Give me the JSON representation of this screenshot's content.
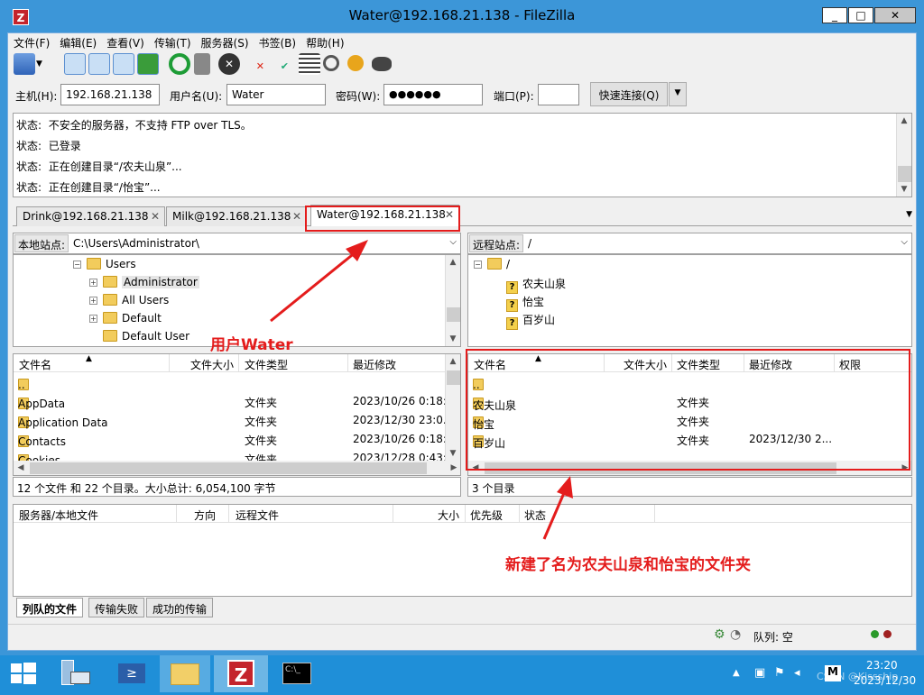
{
  "window": {
    "title": "Water@192.168.21.138 - FileZilla",
    "app_icon": "Z"
  },
  "menu": [
    "文件(F)",
    "编辑(E)",
    "查看(V)",
    "传输(T)",
    "服务器(S)",
    "书签(B)",
    "帮助(H)"
  ],
  "quickconnect": {
    "host_label": "主机(H):",
    "host_value": "192.168.21.138",
    "user_label": "用户名(U):",
    "user_value": "Water",
    "pass_label": "密码(W):",
    "pass_value": "●●●●●●",
    "port_label": "端口(P):",
    "port_value": "",
    "connect_label": "快速连接(Q)"
  },
  "log": [
    {
      "label": "状态:",
      "text": "不安全的服务器，不支持 FTP over TLS。"
    },
    {
      "label": "状态:",
      "text": "已登录"
    },
    {
      "label": "状态:",
      "text": "正在创建目录“/农夫山泉”..."
    },
    {
      "label": "状态:",
      "text": "正在创建目录“/怡宝”..."
    }
  ],
  "tabs": [
    "Drink@192.168.21.138",
    "Milk@192.168.21.138",
    "Water@192.168.21.138"
  ],
  "local": {
    "site_label": "本地站点:",
    "site_path": "C:\\Users\\Administrator\\",
    "tree": [
      "Users",
      "Administrator",
      "All Users",
      "Default",
      "Default User"
    ],
    "headers": [
      "文件名",
      "文件大小",
      "文件类型",
      "最近修改"
    ],
    "rows": [
      {
        "name": "..",
        "size": "",
        "type": "",
        "modified": ""
      },
      {
        "name": "AppData",
        "size": "",
        "type": "文件夹",
        "modified": "2023/10/26 0:18:.."
      },
      {
        "name": "Application Data",
        "size": "",
        "type": "文件夹",
        "modified": "2023/12/30 23:0.."
      },
      {
        "name": "Contacts",
        "size": "",
        "type": "文件夹",
        "modified": "2023/10/26 0:18:.."
      },
      {
        "name": "Cookies",
        "size": "",
        "type": "文件夹",
        "modified": "2023/12/28 0:43:.."
      }
    ],
    "status": "12 个文件 和 22 个目录。大小总计: 6,054,100 字节"
  },
  "remote": {
    "site_label": "远程站点:",
    "site_path": "/",
    "tree_root": "/",
    "tree": [
      "农夫山泉",
      "怡宝",
      "百岁山"
    ],
    "headers": [
      "文件名",
      "文件大小",
      "文件类型",
      "最近修改",
      "权限"
    ],
    "rows": [
      {
        "name": "..",
        "type": "",
        "modified": ""
      },
      {
        "name": "农夫山泉",
        "type": "文件夹",
        "modified": ""
      },
      {
        "name": "怡宝",
        "type": "文件夹",
        "modified": ""
      },
      {
        "name": "百岁山",
        "type": "文件夹",
        "modified": "2023/12/30 2..."
      }
    ],
    "status": "3 个目录"
  },
  "queue": {
    "headers": [
      "服务器/本地文件",
      "方向",
      "远程文件",
      "大小",
      "优先级",
      "状态"
    ],
    "tabs": [
      "列队的文件",
      "传输失败",
      "成功的传输"
    ],
    "queue_status": "队列: 空"
  },
  "annotations": {
    "user": "用户Water",
    "folders": "新建了名为农夫山泉和怡宝的文件夹",
    "color": "#e41c1c"
  },
  "taskbar": {
    "time": "23:20",
    "date": "2023/12/30",
    "watermark": "CSDN @Kissship"
  }
}
